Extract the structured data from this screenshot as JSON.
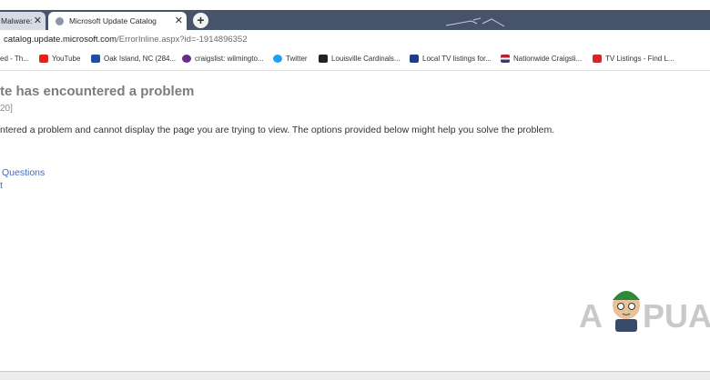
{
  "browser": {
    "tabs": [
      {
        "label": "Malware:",
        "close": "✕"
      },
      {
        "label": "Microsoft Update Catalog",
        "close": "✕"
      }
    ],
    "new_tab": "+",
    "address": {
      "host": "catalog.update.microsoft.com",
      "path": "/ErrorInline.aspx?id=-1914896352"
    },
    "bookmarks": [
      {
        "label": "ed - Th...",
        "icon_color": "#ffffff"
      },
      {
        "label": "YouTube",
        "icon_color": "#e62117"
      },
      {
        "label": "Oak Island, NC (284...",
        "icon_color": "#1f4fa0"
      },
      {
        "label": "craigslist: wilmingto...",
        "icon_color": "#6a2b8f"
      },
      {
        "label": "Twitter",
        "icon_color": "#1da1f2"
      },
      {
        "label": "Louisville Cardinals...",
        "icon_color": "#222222"
      },
      {
        "label": "Local TV listings for...",
        "icon_color": "#1f3c8a"
      },
      {
        "label": "Nationwide Craigsli...",
        "icon_color": "#b22234"
      },
      {
        "label": "TV Listings - Find L...",
        "icon_color": "#d3262a"
      }
    ]
  },
  "page": {
    "heading": "te has encountered a problem",
    "subline": "20]",
    "description": "ntered a problem and cannot display the page you are trying to view. The options provided below might help you solve the problem.",
    "links": [
      "Questions",
      "t"
    ]
  },
  "logo": {
    "text_left": "A",
    "text_right": "PUA"
  },
  "colors": {
    "tabbar": "#46536b",
    "link": "#3f6cc0",
    "heading": "#7d7d7d"
  }
}
